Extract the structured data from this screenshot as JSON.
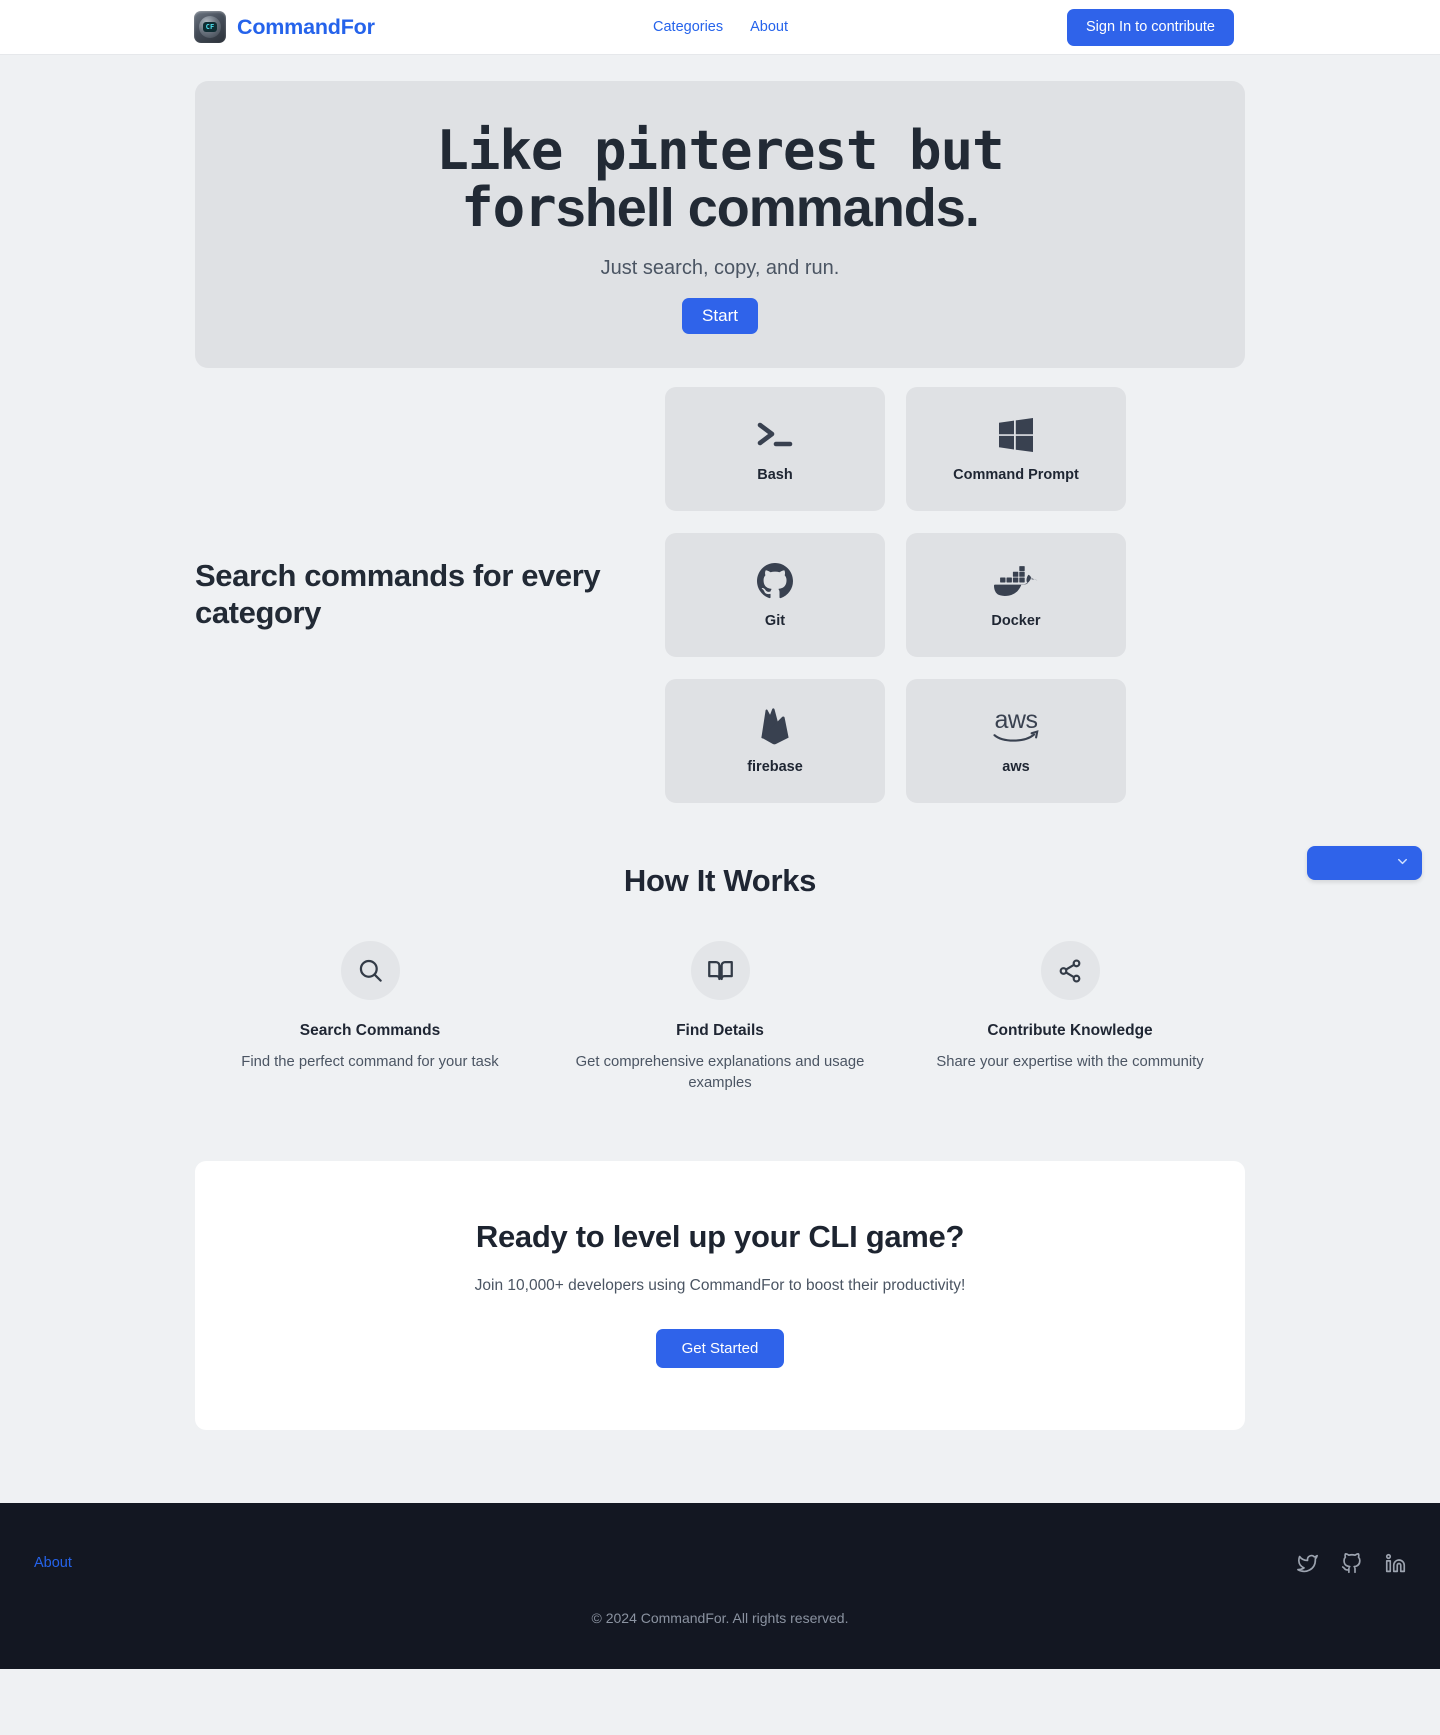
{
  "header": {
    "brand": {
      "name": "CommandFor",
      "logo_icon": "robot-helmet-icon",
      "logo_text": "CF"
    },
    "nav": [
      {
        "label": "Categories",
        "name": "nav-link-categories"
      },
      {
        "label": "About",
        "name": "nav-link-about"
      }
    ],
    "signin_label": "Sign In to contribute",
    "accent_color": "#2f63ea",
    "link_color": "#2563eb"
  },
  "hero": {
    "title_line1": "Like pinterest but",
    "title_line2_a": "for",
    "title_line2_b": "shell commands.",
    "subtitle": "Just search, copy, and run.",
    "button_label": "Start"
  },
  "categories": {
    "heading": "Search commands for every category",
    "items": [
      {
        "label": "Bash",
        "icon": "terminal-prompt-icon"
      },
      {
        "label": "Command Prompt",
        "icon": "windows-logo-icon"
      },
      {
        "label": "Git",
        "icon": "github-octocat-icon"
      },
      {
        "label": "Docker",
        "icon": "docker-whale-icon"
      },
      {
        "label": "firebase",
        "icon": "firebase-flame-icon"
      },
      {
        "label": "aws",
        "icon": "aws-logo-icon"
      }
    ]
  },
  "how_it_works": {
    "title": "How It Works",
    "steps": [
      {
        "icon": "search-icon",
        "title": "Search Commands",
        "desc": "Find the perfect command for your task"
      },
      {
        "icon": "book-open-icon",
        "title": "Find Details",
        "desc": "Get comprehensive explanations and usage examples"
      },
      {
        "icon": "share-icon",
        "title": "Contribute Knowledge",
        "desc": "Share your expertise with the community"
      }
    ]
  },
  "cta": {
    "title": "Ready to level up your CLI game?",
    "subtitle": "Join 10,000+ developers using CommandFor to boost their productivity!",
    "button_label": "Get Started"
  },
  "floating": {
    "icon": "chevron-down-icon",
    "label": ""
  },
  "footer": {
    "link_label": "About",
    "socials": [
      {
        "name": "twitter-icon"
      },
      {
        "name": "github-icon"
      },
      {
        "name": "linkedin-icon"
      }
    ],
    "copyright": "© 2024 CommandFor. All rights reserved."
  }
}
